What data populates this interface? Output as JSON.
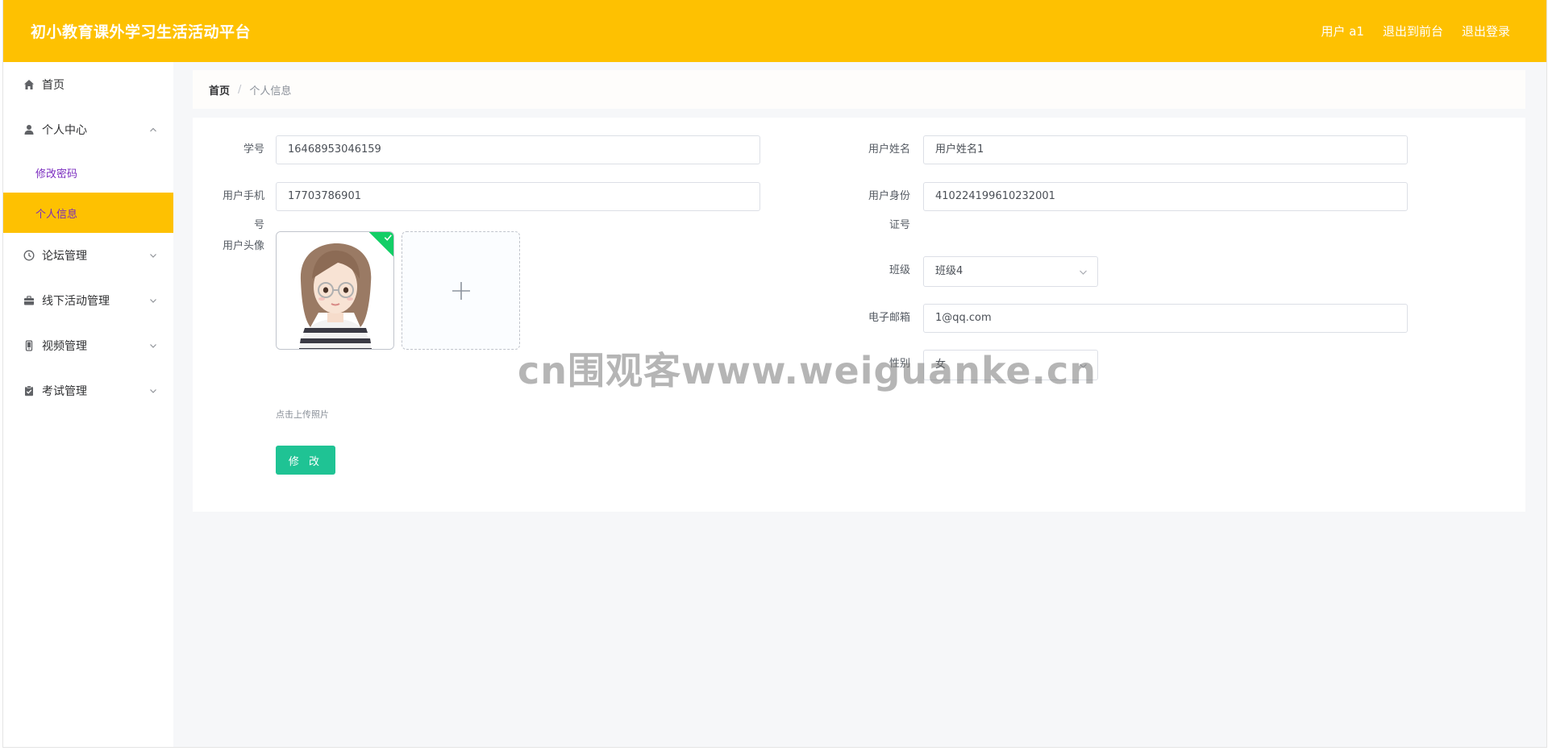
{
  "header": {
    "title": "初小教育课外学习生活活动平台",
    "user_label": "用户 a1",
    "frontend_label": "退出到前台",
    "logout_label": "退出登录"
  },
  "sidebar": {
    "items": [
      {
        "label": "首页",
        "icon": "home-icon"
      },
      {
        "label": "个人中心",
        "icon": "user-icon",
        "expanded": true,
        "children": [
          {
            "label": "修改密码"
          },
          {
            "label": "个人信息",
            "active": true
          }
        ]
      },
      {
        "label": "论坛管理",
        "icon": "clock-icon"
      },
      {
        "label": "线下活动管理",
        "icon": "briefcase-icon"
      },
      {
        "label": "视频管理",
        "icon": "mobile-icon"
      },
      {
        "label": "考试管理",
        "icon": "clipboard-icon"
      }
    ]
  },
  "breadcrumb": {
    "home": "首页",
    "separator": "/",
    "current": "个人信息"
  },
  "form": {
    "student_id": {
      "label": "学号",
      "value": "16468953046159"
    },
    "user_name": {
      "label": "用户姓名",
      "value": "用户姓名1"
    },
    "phone": {
      "label_line1": "用户手机",
      "label_line2": "号",
      "value": "17703786901"
    },
    "id_card": {
      "label_line1": "用户身份",
      "label_line2": "证号",
      "value": "410224199610232001"
    },
    "avatar": {
      "label": "用户头像",
      "hint": "点击上传照片"
    },
    "class": {
      "label": "班级",
      "value": "班级4"
    },
    "email": {
      "label": "电子邮箱",
      "value": "1@qq.com"
    },
    "gender": {
      "label": "性别",
      "value": "女"
    },
    "submit_label": "修 改"
  },
  "watermark": "cn围观客www.weiguanke.cn",
  "colors": {
    "accent": "#fec101",
    "submenu_text": "#7a2bbf",
    "button": "#1fc394",
    "success": "#13ce66"
  }
}
